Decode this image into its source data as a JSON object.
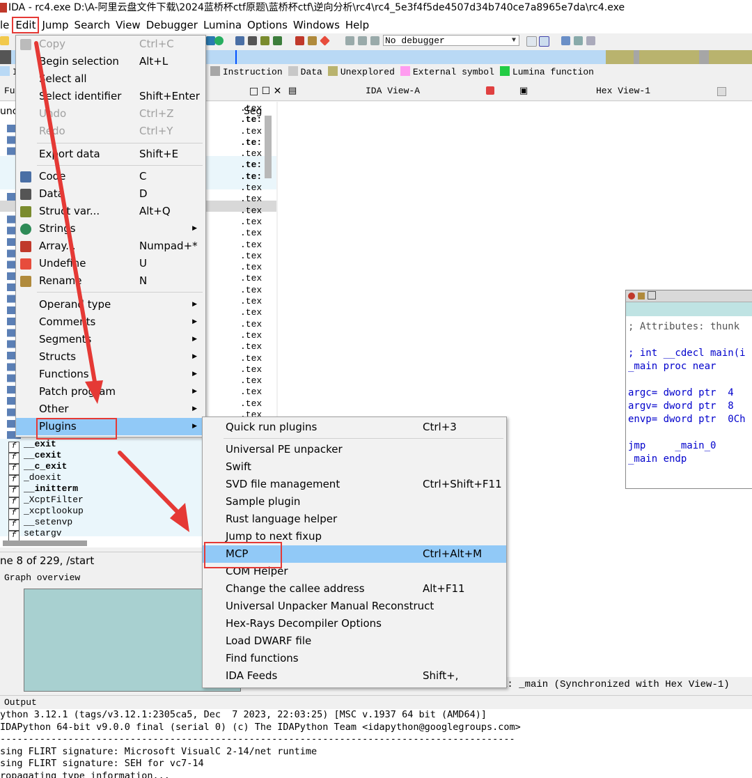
{
  "window": {
    "title": "IDA - rc4.exe D:\\A-阿里云盘文件下载\\2024蓝桥杯ctf原题\\蓝桥杯ctf\\逆向分析\\rc4\\rc4_5e3f4f5de4507d34b740ce7a8965e7da\\rc4.exe"
  },
  "menubar": [
    "le",
    "Edit",
    "Jump",
    "Search",
    "View",
    "Debugger",
    "Lumina",
    "Options",
    "Windows",
    "Help"
  ],
  "toolbar": {
    "debugger_select": "No debugger"
  },
  "legend": {
    "items": [
      {
        "label": "Instruction",
        "color": "#a6a6a6"
      },
      {
        "label": "Data",
        "color": "#c8c8c8"
      },
      {
        "label": "Unexplored",
        "color": "#b9b36e"
      },
      {
        "label": "External symbol",
        "color": "#ff9cf0"
      },
      {
        "label": "Lumina function",
        "color": "#22cc44"
      }
    ],
    "prefix": "I"
  },
  "tabs": {
    "functions": "Fu",
    "ida_view": "IDA View-A",
    "hex_view": "Hex View-1"
  },
  "functions_panel": {
    "column_func": "unc",
    "column_seg": "Seg",
    "seg_values": [
      ".tex",
      ".te:",
      ".tex",
      ".te:",
      ".tex",
      ".te:",
      ".te:",
      ".tex",
      ".tex",
      ".tex",
      ".tex",
      ".tex",
      ".tex",
      ".tex",
      ".tex",
      ".tex",
      ".tex",
      ".tex",
      ".tex",
      ".tex",
      ".tex",
      ".tex",
      ".tex",
      ".tex",
      ".tex",
      ".tex",
      ".tex",
      ".tex",
      ".tex"
    ],
    "visible_functions": [
      "__exit",
      "__cexit",
      "__c_exit",
      "_doexit",
      "__initterm",
      "_XcptFilter",
      "_xcptlookup",
      "__setenvp",
      "setargv"
    ],
    "status": "ne 8 of 229, /start"
  },
  "graph_overview": {
    "title": "Graph overview"
  },
  "edit_menu": {
    "items": [
      {
        "label": "Copy",
        "shortcut": "Ctrl+C",
        "disabled": true
      },
      {
        "label": "Begin selection",
        "shortcut": "Alt+L"
      },
      {
        "label": "Select all",
        "shortcut": ""
      },
      {
        "label": "Select identifier",
        "shortcut": "Shift+Enter"
      },
      {
        "label": "Undo",
        "shortcut": "Ctrl+Z",
        "disabled": true
      },
      {
        "label": "Redo",
        "shortcut": "Ctrl+Y",
        "disabled": true
      },
      {
        "label": "Export data",
        "shortcut": "Shift+E"
      },
      {
        "label": "Code",
        "shortcut": "C"
      },
      {
        "label": "Data",
        "shortcut": "D"
      },
      {
        "label": "Struct var...",
        "shortcut": "Alt+Q"
      },
      {
        "label": "Strings",
        "shortcut": "",
        "submenu": true
      },
      {
        "label": "Array...",
        "shortcut": "Numpad+*"
      },
      {
        "label": "Undefine",
        "shortcut": "U"
      },
      {
        "label": "Rename",
        "shortcut": "N"
      },
      {
        "label": "Operand type",
        "shortcut": "",
        "submenu": true
      },
      {
        "label": "Comments",
        "shortcut": "",
        "submenu": true
      },
      {
        "label": "Segments",
        "shortcut": "",
        "submenu": true
      },
      {
        "label": "Structs",
        "shortcut": "",
        "submenu": true
      },
      {
        "label": "Functions",
        "shortcut": "",
        "submenu": true
      },
      {
        "label": "Patch program",
        "shortcut": "",
        "submenu": true
      },
      {
        "label": "Other",
        "shortcut": "",
        "submenu": true
      },
      {
        "label": "Plugins",
        "shortcut": "",
        "submenu": true,
        "highlighted": true
      }
    ]
  },
  "plugins_menu": {
    "items": [
      {
        "label": "Quick run plugins",
        "shortcut": "Ctrl+3"
      },
      {
        "label": "Universal PE unpacker",
        "shortcut": ""
      },
      {
        "label": "Swift",
        "shortcut": ""
      },
      {
        "label": "SVD file management",
        "shortcut": "Ctrl+Shift+F11"
      },
      {
        "label": "Sample plugin",
        "shortcut": ""
      },
      {
        "label": "Rust language helper",
        "shortcut": ""
      },
      {
        "label": "Jump to next fixup",
        "shortcut": ""
      },
      {
        "label": "MCP",
        "shortcut": "Ctrl+Alt+M",
        "highlighted": true
      },
      {
        "label": "COM Helper",
        "shortcut": ""
      },
      {
        "label": "Change the callee address",
        "shortcut": "Alt+F11"
      },
      {
        "label": "Universal Unpacker Manual Reconstruct",
        "shortcut": ""
      },
      {
        "label": "Hex-Rays Decompiler Options",
        "shortcut": ""
      },
      {
        "label": "Load DWARF file",
        "shortcut": ""
      },
      {
        "label": "Find functions",
        "shortcut": ""
      },
      {
        "label": "IDA Feeds",
        "shortcut": "Shift+,"
      }
    ]
  },
  "code_view": {
    "lines": [
      "; Attributes: thunk",
      "",
      "; int __cdecl main(i",
      "_main proc near",
      "",
      "argc= dword ptr  4",
      "argv= dword ptr  8",
      "envp= dword ptr  0Ch",
      "",
      "jmp     _main_0",
      "_main endp"
    ]
  },
  "sync_status": "A: _main (Synchronized with Hex View-1)",
  "output": {
    "title": "Output",
    "lines": [
      "ython 3.12.1 (tags/v3.12.1:2305ca5, Dec  7 2023, 22:03:25) [MSC v.1937 64 bit (AMD64)]",
      "IDAPython 64-bit v9.0.0 final (serial 0) (c) The IDAPython Team <idapython@googlegroups.com>",
      "-------------------------------------------------------------------------------------------",
      "sing FLIRT signature: Microsoft VisualC 2-14/net runtime",
      "sing FLIRT signature: SEH for vc7-14",
      "ropagating type information..."
    ]
  },
  "colors": {
    "highlight": "#91c9f7",
    "annotation_red": "#e53935",
    "nav_band": "#b9d9f5",
    "graph_overview": "#a8d0d0"
  }
}
